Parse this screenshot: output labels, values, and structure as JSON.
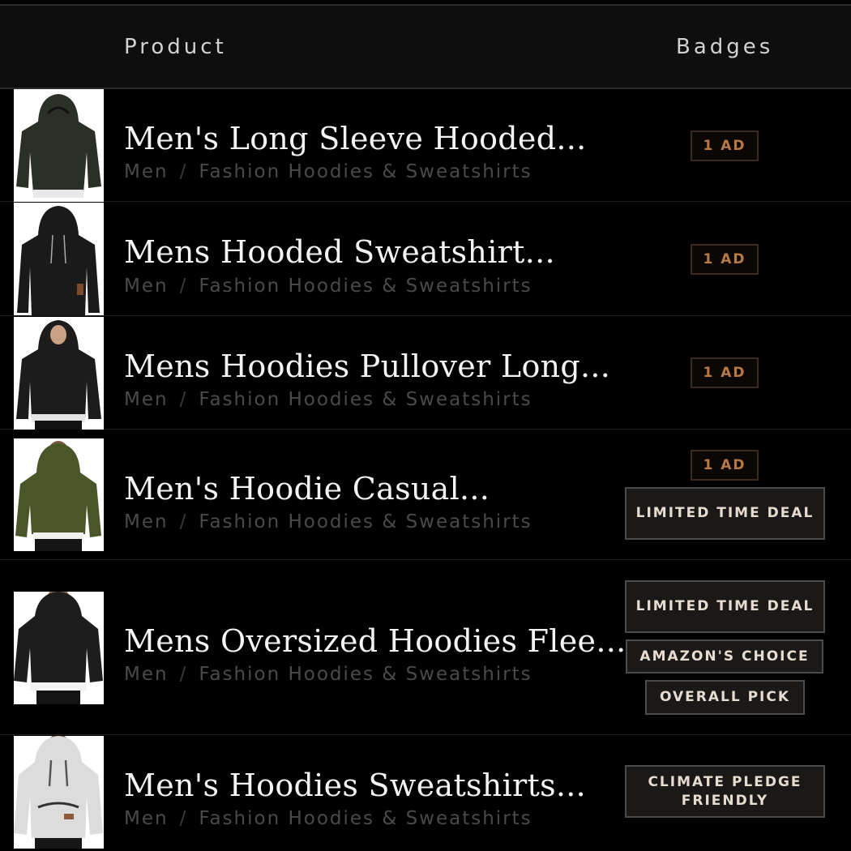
{
  "header": {
    "product_label": "Product",
    "badges_label": "Badges"
  },
  "rows": [
    {
      "title": "Men's Long Sleeve Hooded...",
      "category": "Men",
      "subcategory": "Fashion Hoodies & Sweatshirts",
      "badges": [
        "1 AD"
      ],
      "hoodie_color": "#2c2f28"
    },
    {
      "title": "Mens Hooded Sweatshirt...",
      "category": "Men",
      "subcategory": "Fashion Hoodies & Sweatshirts",
      "badges": [
        "1 AD"
      ],
      "hoodie_color": "#1a1a1a"
    },
    {
      "title": "Mens Hoodies Pullover Long...",
      "category": "Men",
      "subcategory": "Fashion Hoodies & Sweatshirts",
      "badges": [
        "1 AD"
      ],
      "hoodie_color": "#1c1c1c"
    },
    {
      "title": "Men's Hoodie Casual...",
      "category": "Men",
      "subcategory": "Fashion Hoodies & Sweatshirts",
      "badges": [
        "1 AD",
        "LIMITED TIME DEAL"
      ],
      "hoodie_color": "#4a5528"
    },
    {
      "title": "Mens Oversized Hoodies Flee...",
      "category": "Men",
      "subcategory": "Fashion Hoodies & Sweatshirts",
      "badges": [
        "LIMITED TIME DEAL",
        "AMAZON'S CHOICE",
        "OVERALL PICK"
      ],
      "hoodie_color": "#1d1d1d"
    },
    {
      "title": "Men's Hoodies Sweatshirts...",
      "category": "Men",
      "subcategory": "Fashion Hoodies & Sweatshirts",
      "badges": [
        "CLIMATE PLEDGE FRIENDLY"
      ],
      "hoodie_color": "#dcdcdc"
    }
  ],
  "breadcrumb_separator": "/",
  "colors": {
    "background": "#000000",
    "header_background": "#0e0e0f",
    "ad_badge_text": "#b87a45",
    "badge_text": "#e6dccf"
  }
}
